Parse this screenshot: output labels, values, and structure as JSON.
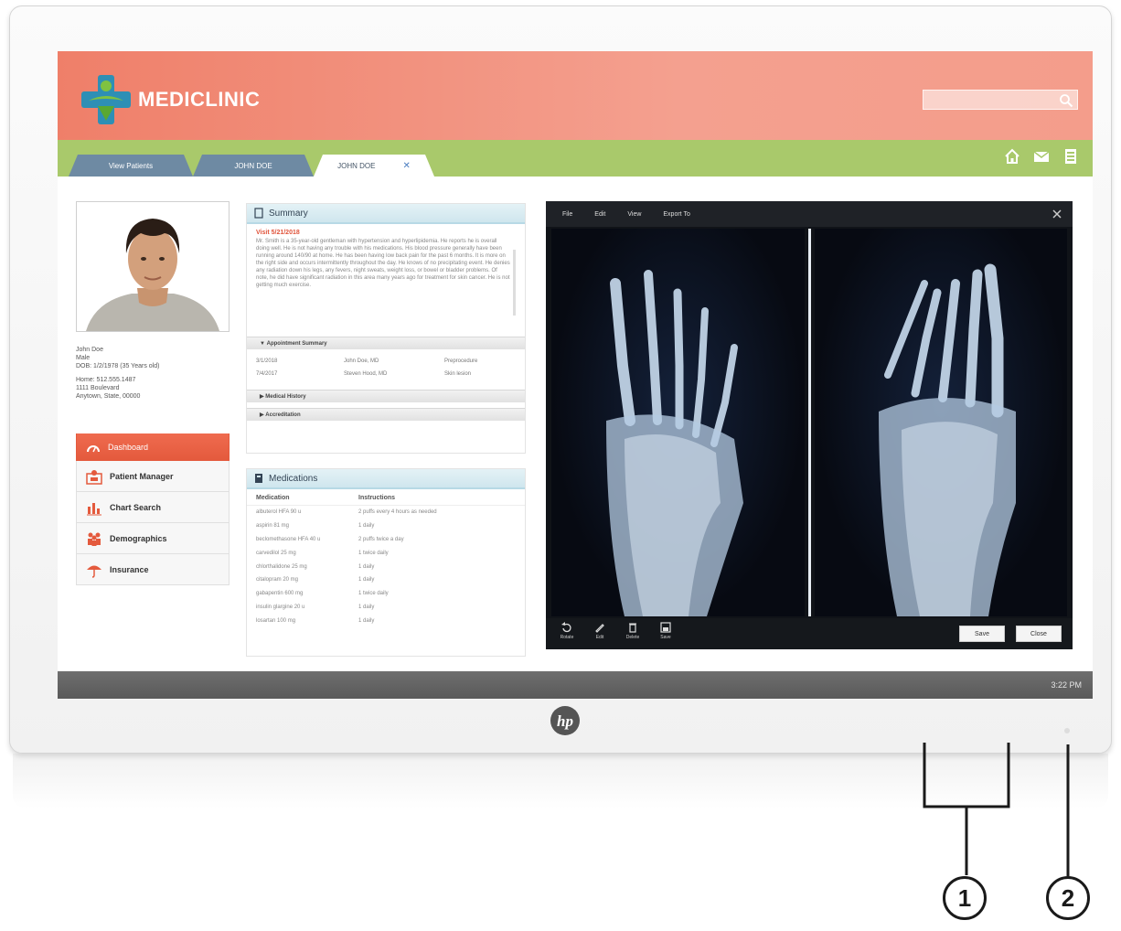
{
  "app": {
    "brand": "MEDICLINIC",
    "search_placeholder": ""
  },
  "tabs": [
    {
      "label": "View Patients"
    },
    {
      "label": "JOHN DOE"
    },
    {
      "label": "JOHN DOE",
      "close": "✕"
    }
  ],
  "patient": {
    "name": "John Doe",
    "sex": "Male",
    "dob": "DOB: 1/2/1978 (35 Years old)",
    "phone": "Home: 512.555.1487",
    "address1": "1111 Boulevard",
    "address2": "Anytown, State, 00000"
  },
  "nav": [
    {
      "label": "Dashboard",
      "icon": "dashboard-icon"
    },
    {
      "label": "Patient Manager",
      "icon": "patient-manager-icon"
    },
    {
      "label": "Chart Search",
      "icon": "chart-search-icon"
    },
    {
      "label": "Demographics",
      "icon": "demographics-icon"
    },
    {
      "label": "Insurance",
      "icon": "insurance-icon"
    }
  ],
  "summary": {
    "title": "Summary",
    "visit": "Visit 5/21/2018",
    "text": "Mr. Smith is a 35-year-old gentleman with hypertension and hyperlipidemia. He reports he is overall doing well. He is not having any trouble with his medications. His blood pressure generally have been running around 140/90 at home. He has been having low back pain for the past 6 months. It is more on the right side and occurs intermittently throughout the day. He knows of no precipitating event. He denies any radiation down his legs, any fevers, night sweats, weight loss, or bowel or bladder problems. Of note, he did have significant radiation in this area many years ago for treatment for skin cancer. He is not getting much exercise.",
    "appointment_summary": "Appointment Summary",
    "appointments": [
      {
        "date": "3/1/2018",
        "doctor": "John Doe, MD",
        "type": "Preprocedure"
      },
      {
        "date": "7/4/2017",
        "doctor": "Steven Hood, MD",
        "type": "Skin lesion"
      }
    ],
    "medical_history": "Medical History",
    "accreditation": "Accreditation"
  },
  "medications": {
    "title": "Medications",
    "col_med": "Medication",
    "col_instr": "Instructions",
    "rows": [
      {
        "med": "albuterol HFA 90 u",
        "instr": "2 puffs every 4 hours as needed"
      },
      {
        "med": "aspirin 81 mg",
        "instr": "1 daily"
      },
      {
        "med": "beclomethasone HFA 40 u",
        "instr": "2 puffs twice a day"
      },
      {
        "med": "carvedilol 25 mg",
        "instr": "1 twice daily"
      },
      {
        "med": "chlorthalidone 25 mg",
        "instr": "1 daily"
      },
      {
        "med": "citalopram 20 mg",
        "instr": "1 daily"
      },
      {
        "med": "gabapentin 600 mg",
        "instr": "1 twice daily"
      },
      {
        "med": "insulin glargine 20 u",
        "instr": "1 daily"
      },
      {
        "med": "losartan 100 mg",
        "instr": "1 daily"
      }
    ]
  },
  "viewer": {
    "menu": [
      "File",
      "Edit",
      "View",
      "Export To"
    ],
    "tools": [
      "Rotate",
      "Edit",
      "Delete",
      "Save"
    ],
    "save_button": "Save",
    "close_button": "Close"
  },
  "status": {
    "time": "3:22 PM"
  },
  "callouts": [
    "1",
    "2"
  ],
  "colors": {
    "header": "#ef7f69",
    "tabbar": "#a9c96b",
    "nav_active": "#e45a3d",
    "panel_title": "#cfe6ee"
  }
}
